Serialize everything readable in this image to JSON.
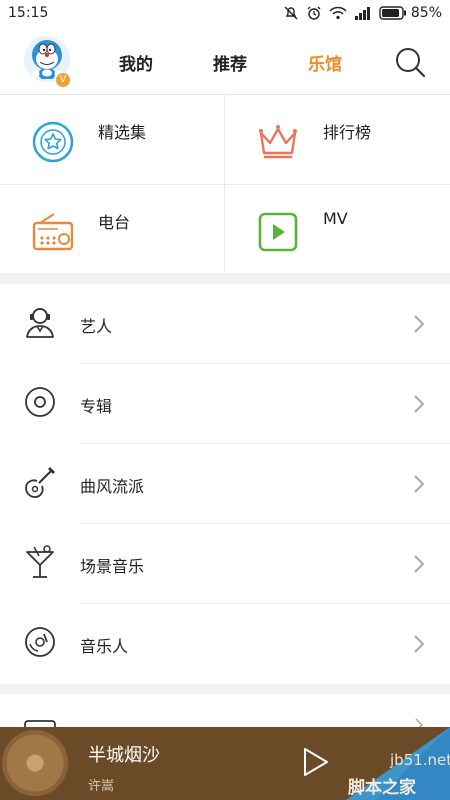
{
  "status_bar": {
    "time": "15:15",
    "battery": "85%"
  },
  "nav": {
    "tabs": [
      "我的",
      "推荐",
      "乐馆"
    ],
    "active_tab": "乐馆",
    "accent_color": "#f08a24"
  },
  "grid": {
    "items": [
      {
        "label": "精选集",
        "icon": "star-circle-icon",
        "color": "#2aa4d9"
      },
      {
        "label": "排行榜",
        "icon": "crown-icon",
        "color": "#e9765a"
      },
      {
        "label": "电台",
        "icon": "radio-icon",
        "color": "#e78a3e"
      },
      {
        "label": "MV",
        "icon": "play-square-icon",
        "color": "#59b53a"
      }
    ]
  },
  "categories": {
    "items": [
      {
        "label": "艺人",
        "icon": "artist-icon"
      },
      {
        "label": "专辑",
        "icon": "album-disc-icon"
      },
      {
        "label": "曲风流派",
        "icon": "guitar-icon"
      },
      {
        "label": "场景音乐",
        "icon": "cocktail-icon"
      },
      {
        "label": "音乐人",
        "icon": "musician-disc-icon"
      }
    ]
  },
  "player": {
    "title": "半城烟沙",
    "artist": "许嵩"
  },
  "watermark": {
    "line1": "jb51.net",
    "line2": "脚本之家"
  }
}
